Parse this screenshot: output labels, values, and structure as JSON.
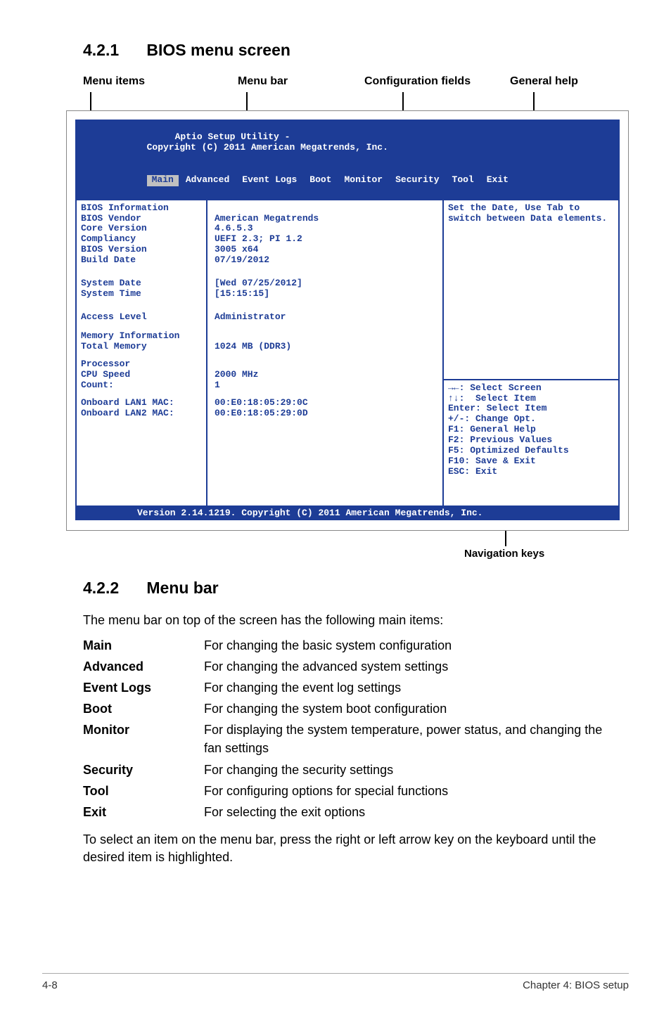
{
  "section1": {
    "num": "4.2.1",
    "title": "BIOS menu screen"
  },
  "diag": {
    "menu_items": "Menu items",
    "menu_bar": "Menu bar",
    "conf_fields": "Configuration fields",
    "gen_help": "General help",
    "nav_keys": "Navigation keys"
  },
  "bios": {
    "header_line1_left": "Aptio Setup Utility -",
    "header_line1_mid": "Copyright (C) 2011 A",
    "header_line1_right": "merican Megatrends, Inc.",
    "tabs": {
      "main": "Main",
      "rest": "Advanced  Event Logs  Boot  Monitor  Security  Tool  Exit",
      "list": [
        "Advanced",
        "Event Logs",
        "Boot",
        "Monitor",
        "Security",
        "Tool",
        "Exit"
      ]
    },
    "left": {
      "bios_info": "BIOS Information",
      "bios_vendor": "BIOS Vendor",
      "core_version": "Core Version",
      "compliancy": "Compliancy",
      "bios_version": "BIOS Version",
      "build_date": "Build Date",
      "system_date": "System Date",
      "system_time": "System Time",
      "access_level": "Access Level",
      "mem_info": "Memory Information",
      "total_memory": "Total Memory",
      "processor": "Processor",
      "cpu_speed": "CPU Speed",
      "count": "Count:",
      "lan1": "Onboard LAN1 MAC:",
      "lan2": "Onboard LAN2 MAC:"
    },
    "mid": {
      "vendor_val": "American Megatrends",
      "core_val": "4.6.5.3",
      "compliancy_val": "UEFI 2.3; PI 1.2",
      "bios_ver_val": "3005 x64",
      "build_date_val": "07/19/2012",
      "sys_date_val": "[Wed 07/25/2012]",
      "sys_time_val": "[15:15:15]",
      "access_val": "Administrator",
      "total_mem_val": "1024 MB (DDR3)",
      "cpu_speed_val": "2000 MHz",
      "count_val": "1",
      "lan1_val": "00:E0:18:05:29:0C",
      "lan2_val": "00:E0:18:05:29:0D"
    },
    "help_top1": "Set the Date, Use Tab to",
    "help_top2": "switch between Data elements.",
    "help_bottom": [
      "→←: Select Screen",
      "↑↓:  Select Item",
      "Enter: Select Item",
      "+/-: Change Opt.",
      "F1: General Help",
      "F2: Previous Values",
      "F5: Optimized Defaults",
      "F10: Save & Exit",
      "ESC: Exit"
    ],
    "version_bar": "Version 2.14.1219. Copyright (C) 2011 American Megatrends, Inc."
  },
  "section2": {
    "num": "4.2.2",
    "title": "Menu bar"
  },
  "intro": "The menu bar on top of the screen has the following main items:",
  "defs": [
    {
      "term": "Main",
      "desc": "For changing the basic system configuration"
    },
    {
      "term": "Advanced",
      "desc": "For changing the advanced system settings"
    },
    {
      "term": "Event Logs",
      "desc": "For changing the event log settings"
    },
    {
      "term": "Boot",
      "desc": "For changing the system boot configuration"
    },
    {
      "term": "Monitor",
      "desc": "For displaying the system temperature, power status, and changing the fan settings"
    },
    {
      "term": "Security",
      "desc": "For changing the security settings"
    },
    {
      "term": "Tool",
      "desc": "For configuring options for special functions"
    },
    {
      "term": "Exit",
      "desc": "For selecting the exit options"
    }
  ],
  "closing": "To select an item on the menu bar, press the right or left arrow key on the keyboard until the desired item is highlighted.",
  "footer": {
    "left": "4-8",
    "right": "Chapter 4: BIOS setup"
  }
}
